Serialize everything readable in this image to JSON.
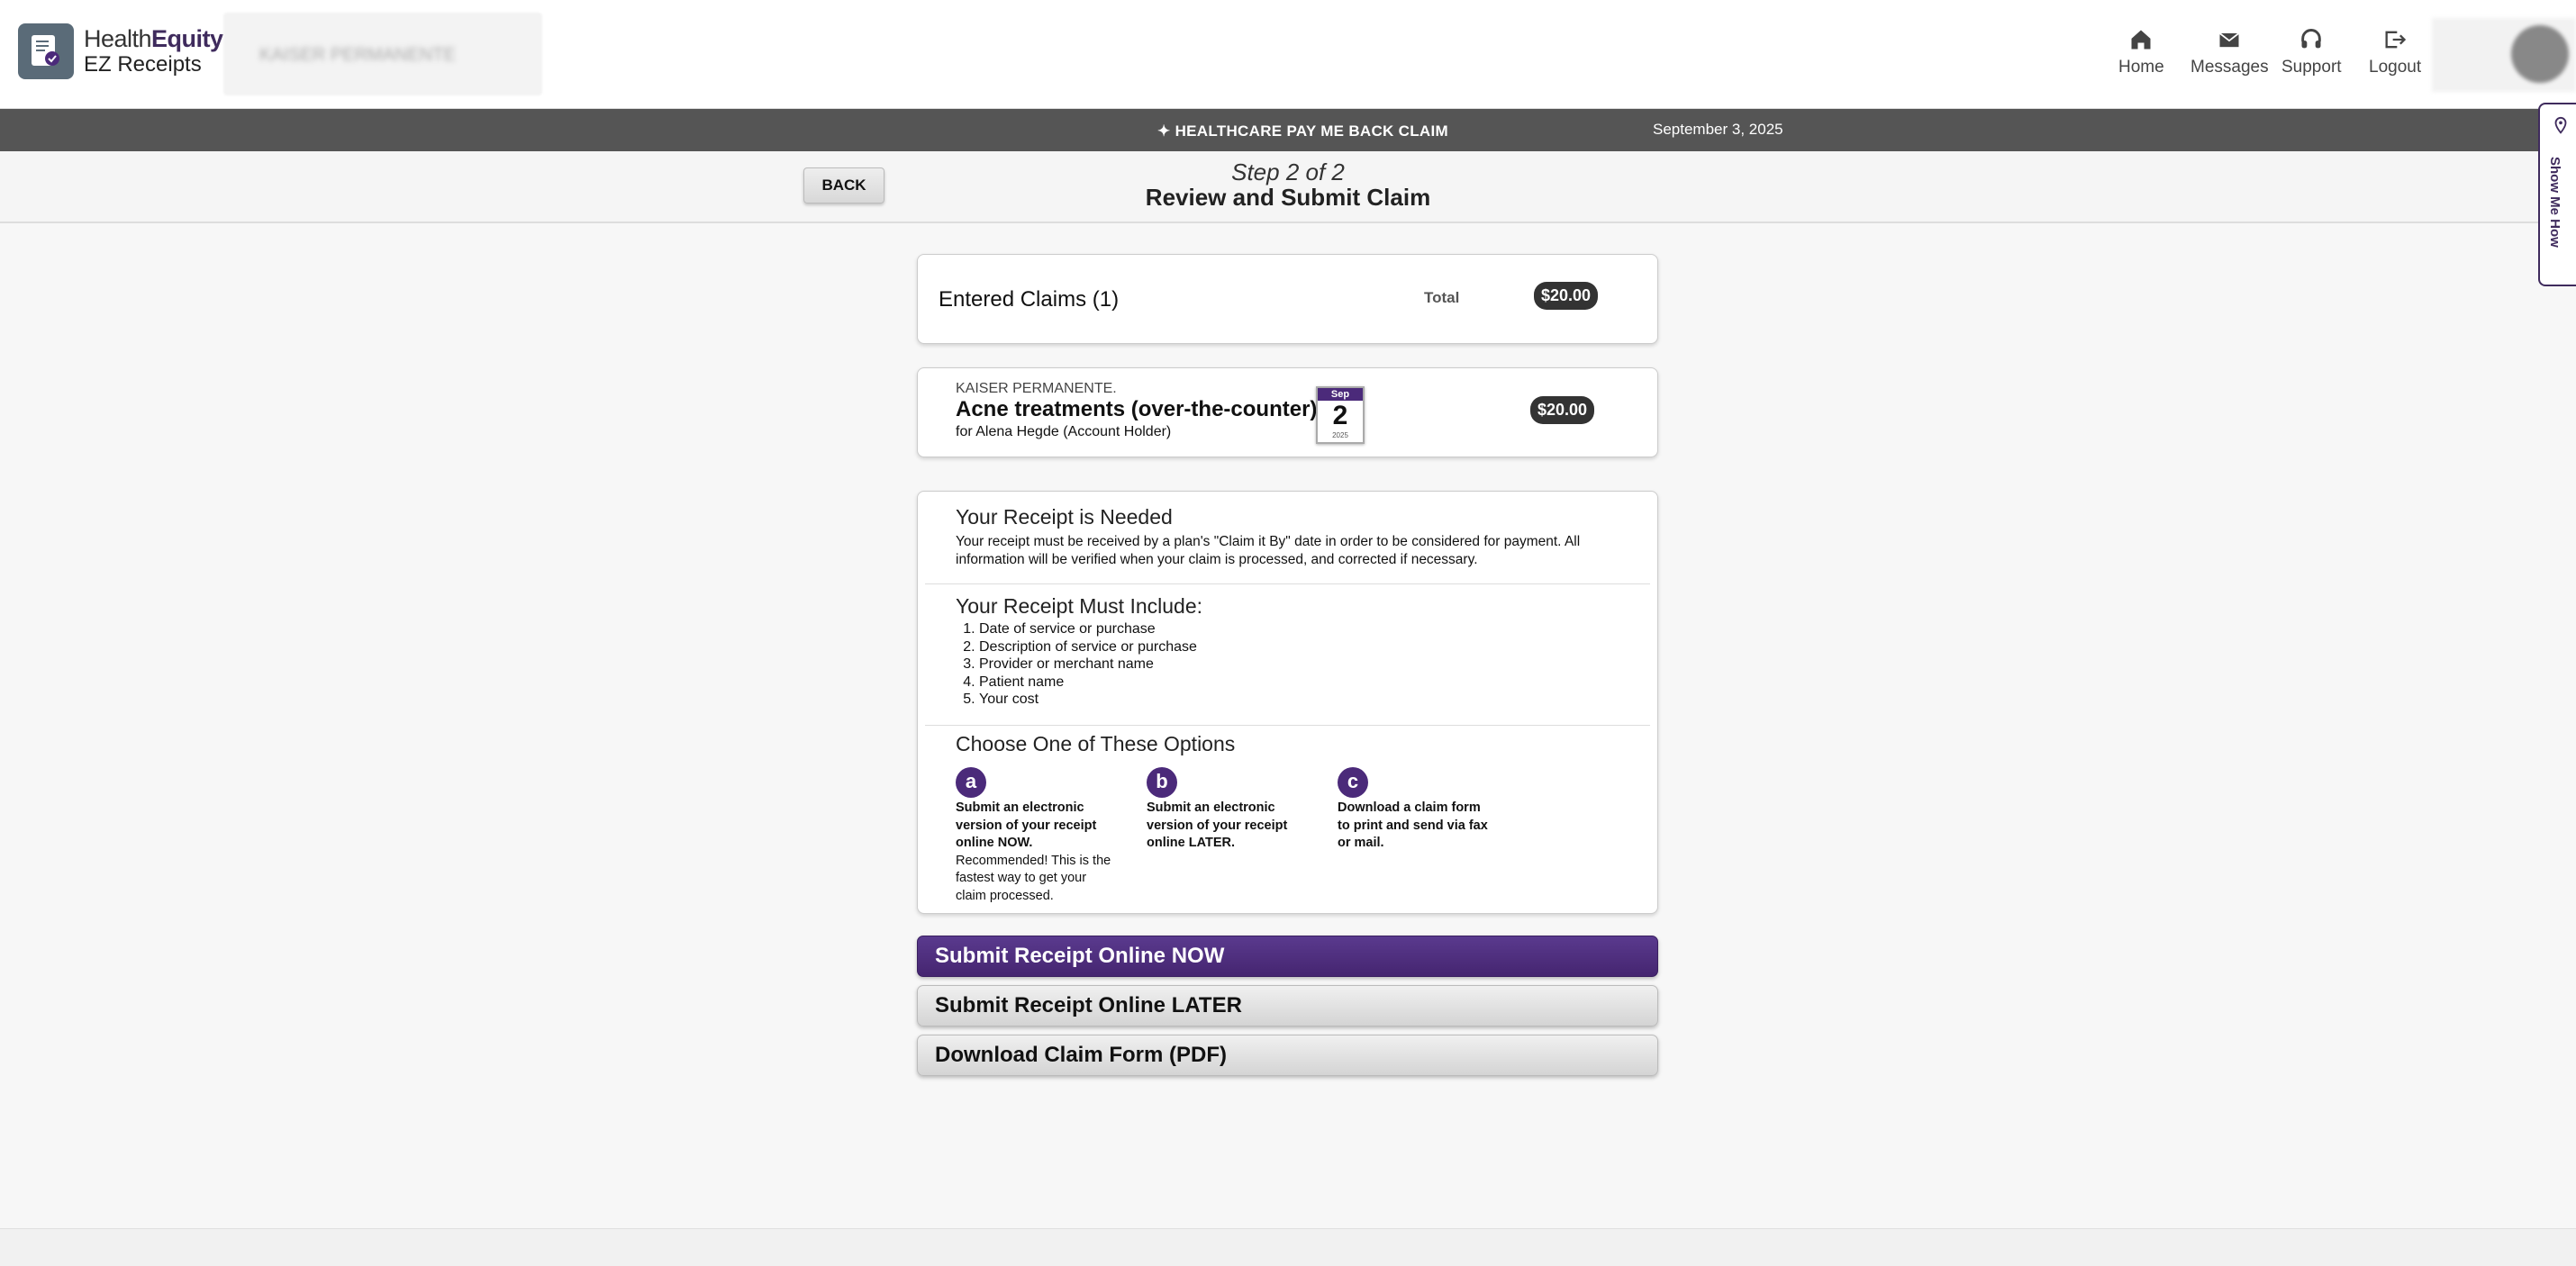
{
  "brand": {
    "name_regular": "Health",
    "name_bold": "Equity",
    "product": "EZ Receipts"
  },
  "header_plan": {
    "text": "KAISER PERMANENTE"
  },
  "nav": [
    {
      "label": "Home",
      "icon": "home-icon"
    },
    {
      "label": "Messages",
      "icon": "mail-icon"
    },
    {
      "label": "Support",
      "icon": "headset-icon"
    },
    {
      "label": "Logout",
      "icon": "logout-icon"
    }
  ],
  "banner": {
    "claim_type": "HEALTHCARE PAY ME BACK CLAIM",
    "date": "September 3, 2025"
  },
  "step": {
    "back": "BACK",
    "label": "Step 2 of 2",
    "title": "Review and Submit Claim"
  },
  "summary": {
    "title": "Entered Claims (1)",
    "total_label": "Total",
    "total": "$20.00"
  },
  "claim": {
    "provider": "KAISER PERMANENTE.",
    "service": "Acne treatments (over-the-counter)",
    "for": "for Alena Hegde (Account Holder)",
    "cal_month": "Sep",
    "cal_day": "2",
    "cal_year": "2025",
    "amount": "$20.00"
  },
  "receipt": {
    "needed_title": "Your Receipt is Needed",
    "needed_text": "Your receipt must be received by a plan's \"Claim it By\" date in order to be considered for payment. All information will be verified when your claim is processed, and corrected if necessary.",
    "include_title": "Your Receipt Must Include:",
    "include_items": [
      "Date of service or purchase",
      "Description of service or purchase",
      "Provider or merchant name",
      "Patient name",
      "Your cost"
    ],
    "options_title": "Choose One of These Options",
    "options": [
      {
        "letter": "a",
        "bold": "Submit an electronic version of your receipt online NOW.",
        "text": "Recommended! This is the fastest way to get your claim processed."
      },
      {
        "letter": "b",
        "bold": "Submit an electronic version of your receipt online LATER.",
        "text": ""
      },
      {
        "letter": "c",
        "bold": "Download a claim form to print and send via fax or mail.",
        "text": ""
      }
    ]
  },
  "buttons": {
    "now": "Submit Receipt Online NOW",
    "later": "Submit Receipt Online LATER",
    "pdf": "Download Claim Form (PDF)"
  },
  "show_me_how": "Show Me How",
  "colors": {
    "brand_purple": "#4b2a7a",
    "banner": "#555555"
  }
}
